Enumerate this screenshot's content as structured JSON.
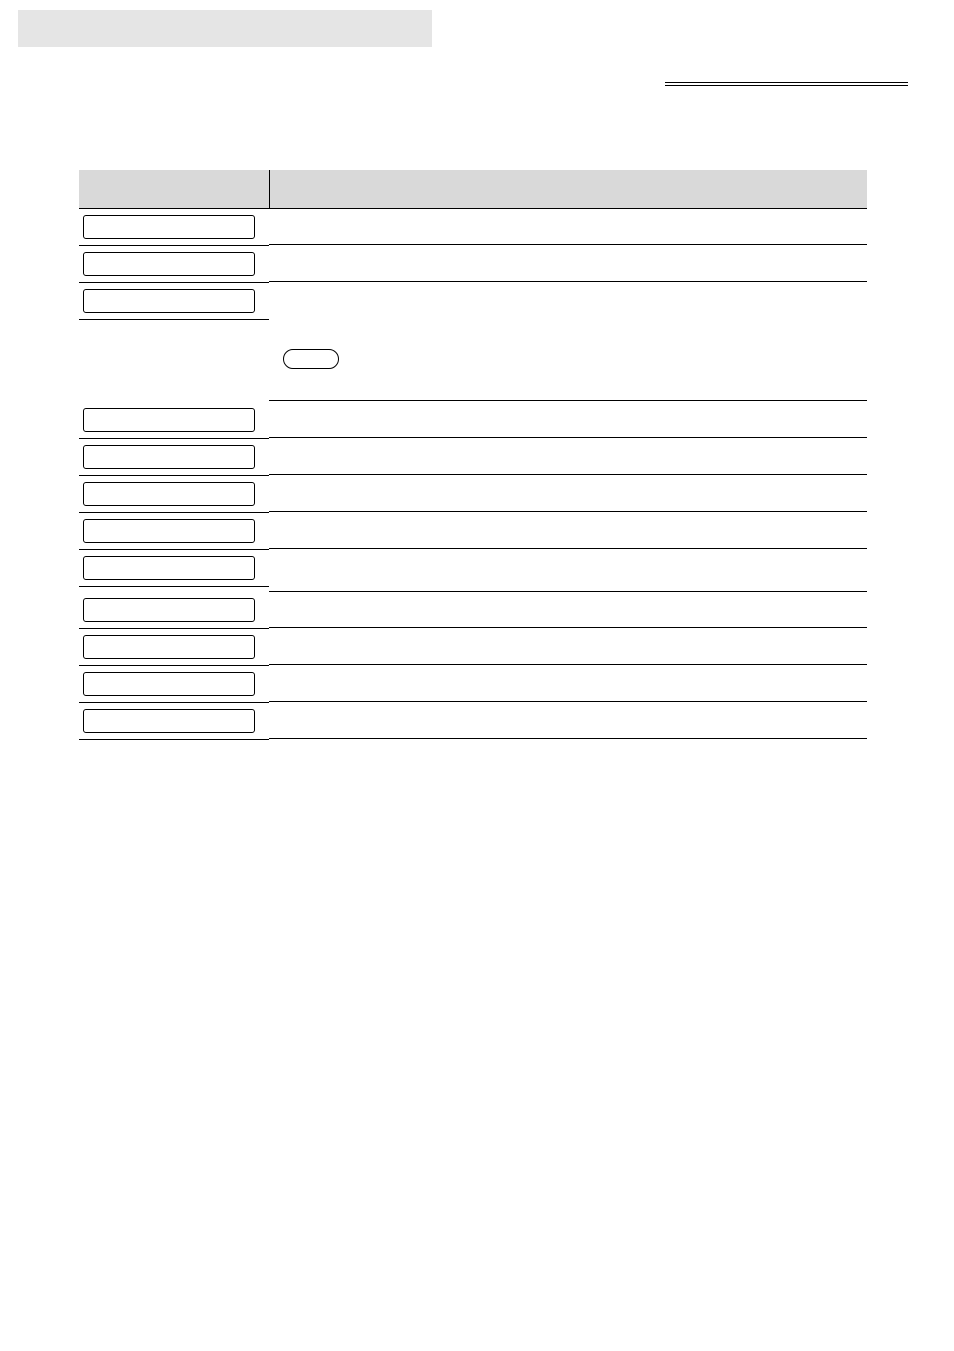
{
  "header": {
    "top_bar_label": "",
    "section_rule_label": ""
  },
  "table": {
    "header": {
      "button_col": "",
      "description_col": ""
    },
    "rows": [
      {
        "button_label": "",
        "description": "",
        "kind": "normal"
      },
      {
        "button_label": "",
        "description": "",
        "kind": "normal"
      },
      {
        "button_label": "",
        "description": "",
        "kind": "tall_with_pill",
        "pill_label": ""
      },
      {
        "button_label": "",
        "description": "",
        "kind": "normal"
      },
      {
        "button_label": "",
        "description": "",
        "kind": "normal"
      },
      {
        "button_label": "",
        "description": "",
        "kind": "normal"
      },
      {
        "button_label": "",
        "description": "",
        "kind": "normal"
      },
      {
        "button_label": "",
        "description": "",
        "kind": "normal"
      },
      {
        "button_label": "",
        "description": "",
        "kind": "normal"
      },
      {
        "button_label": "",
        "description": "",
        "kind": "normal"
      },
      {
        "button_label": "",
        "description": "",
        "kind": "normal"
      },
      {
        "button_label": "",
        "description": "",
        "kind": "normal"
      }
    ]
  }
}
